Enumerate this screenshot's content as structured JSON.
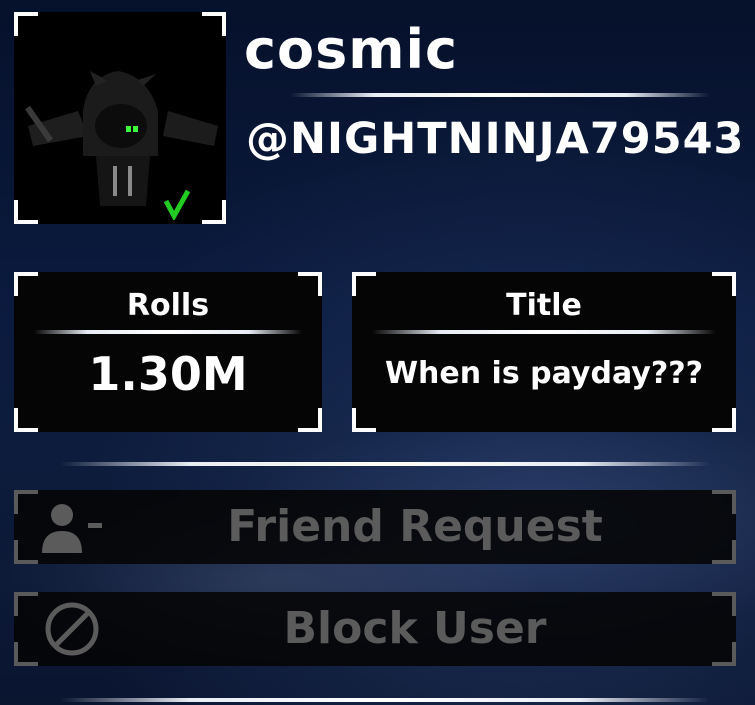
{
  "profile": {
    "display_name": "cosmic",
    "username": "@NIGHTNINJA79543",
    "avatar_icon": "roblox-avatar-hooded-ninja"
  },
  "stats": {
    "rolls": {
      "label": "Rolls",
      "value": "1.30M"
    },
    "title": {
      "label": "Title",
      "value": "When is payday???"
    }
  },
  "actions": {
    "friend_request": {
      "label": "Friend Request",
      "icon": "add-friend-icon",
      "enabled": false
    },
    "block_user": {
      "label": "Block User",
      "icon": "block-icon",
      "enabled": false
    }
  },
  "colors": {
    "background": "#0a1630",
    "text": "#ffffff",
    "disabled_text": "#5b5b5b",
    "box_fill": "#050505"
  }
}
